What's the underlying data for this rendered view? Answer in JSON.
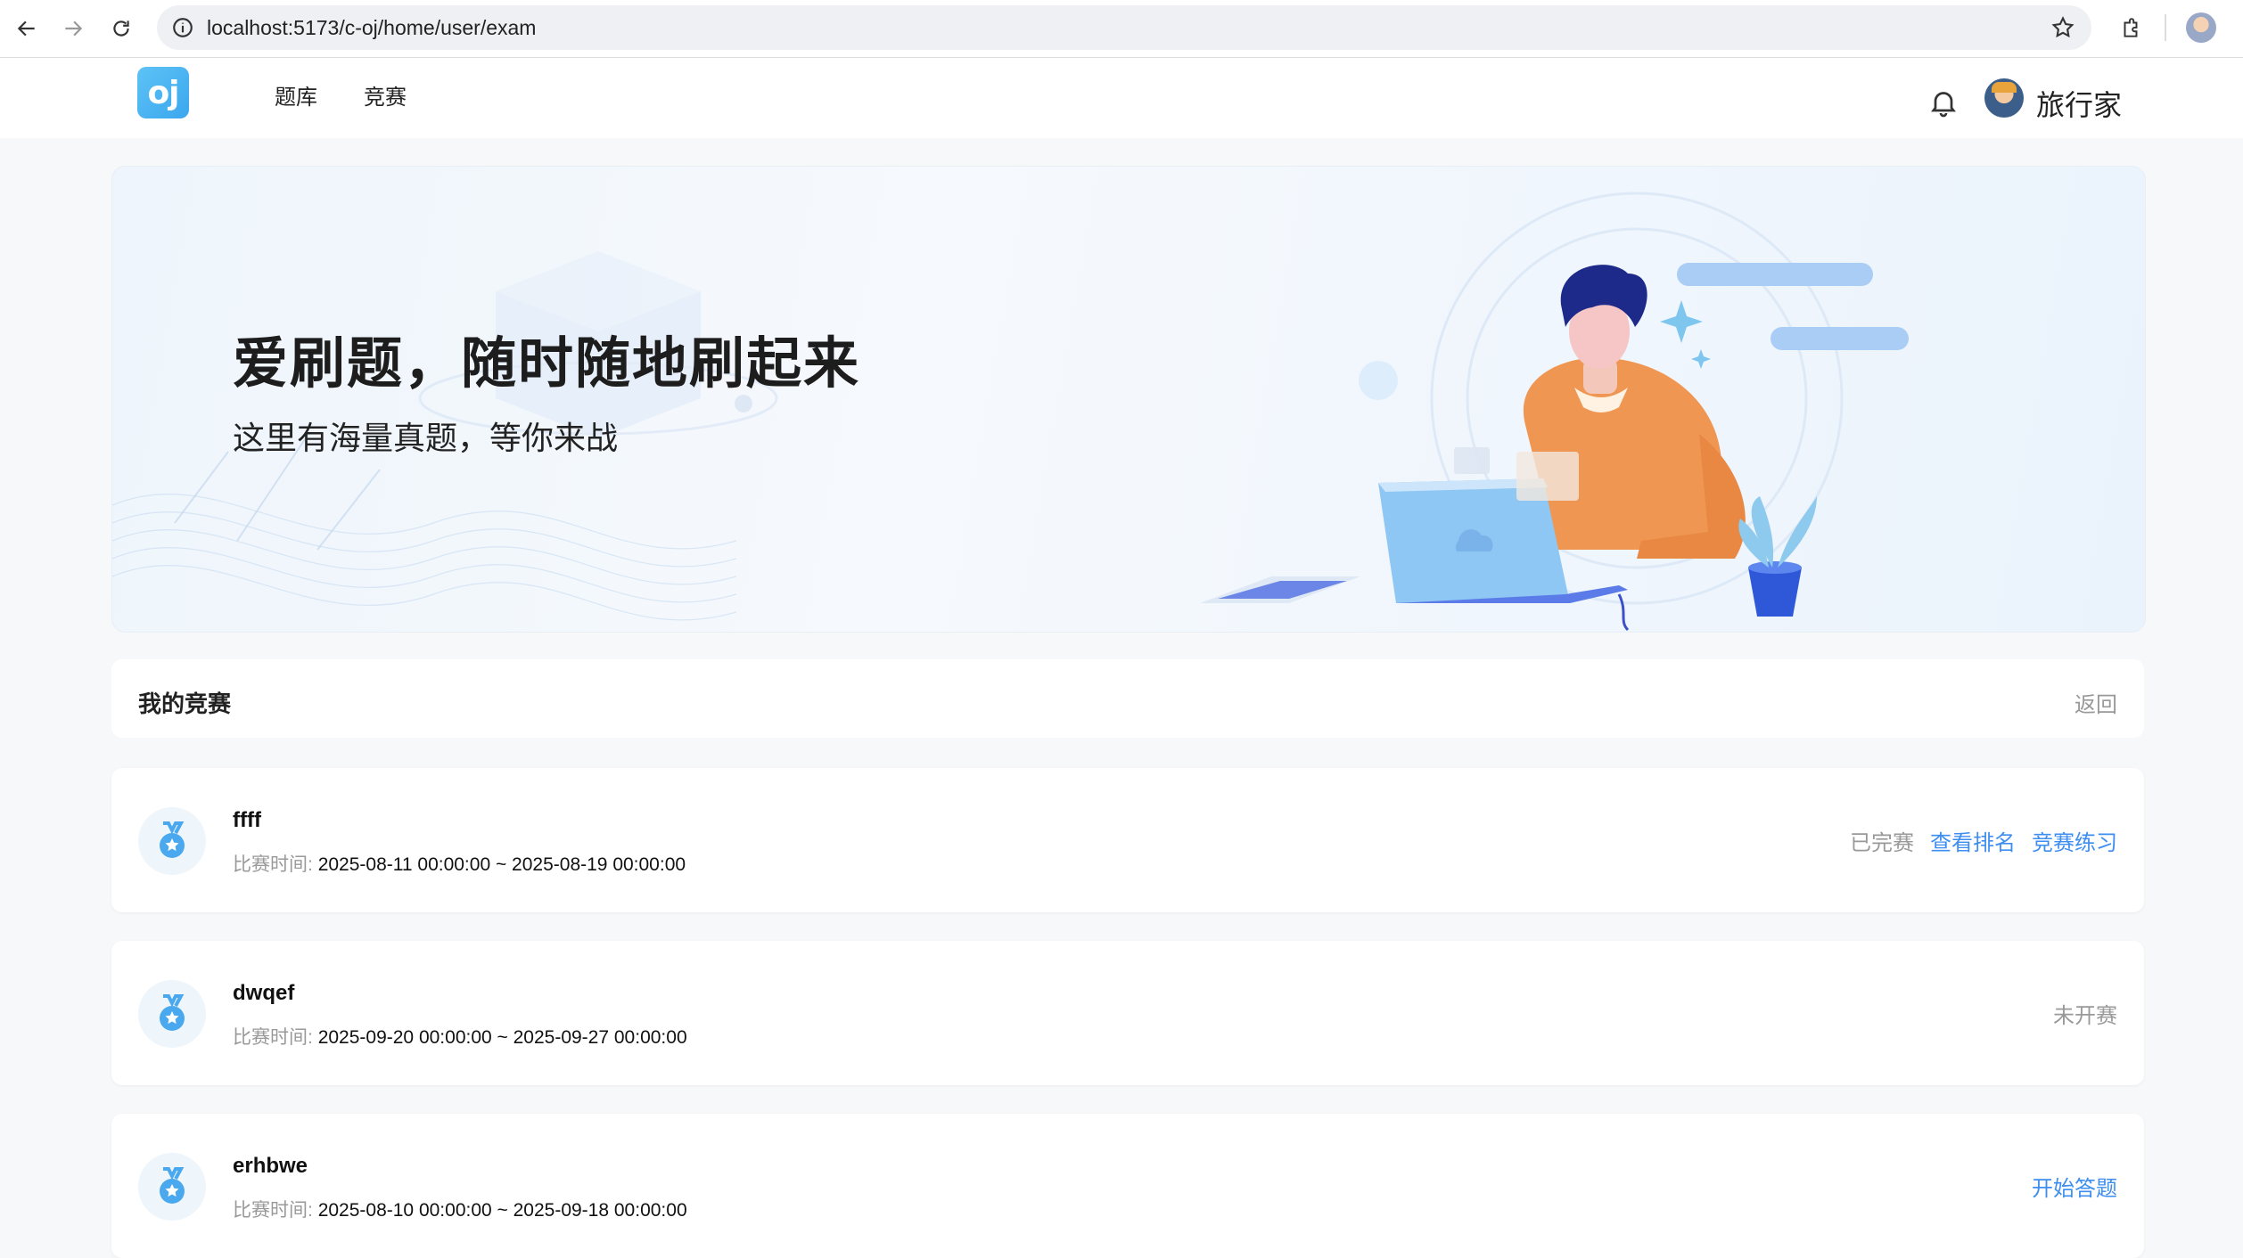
{
  "browser": {
    "url": "localhost:5173/c-oj/home/user/exam"
  },
  "header": {
    "logo_text": "oj",
    "nav": [
      {
        "label": "题库"
      },
      {
        "label": "竞赛"
      }
    ],
    "username": "旅行家"
  },
  "banner": {
    "title": "爱刷题，随时随地刷起来",
    "subtitle": "这里有海量真题，等你来战"
  },
  "section": {
    "title": "我的竞赛",
    "back_label": "返回"
  },
  "exams": [
    {
      "name": "ffff",
      "time_label": "比赛时间:",
      "time_value": "2025-08-11 00:00:00 ~ 2025-08-19 00:00:00",
      "status": "已完赛",
      "actions": [
        "查看排名",
        "竞赛练习"
      ]
    },
    {
      "name": "dwqef",
      "time_label": "比赛时间:",
      "time_value": "2025-09-20 00:00:00 ~ 2025-09-27 00:00:00",
      "status": "未开赛",
      "actions": []
    },
    {
      "name": "erhbwe",
      "time_label": "比赛时间:",
      "time_value": "2025-08-10 00:00:00 ~ 2025-09-18 00:00:00",
      "status": "",
      "actions": [
        "开始答题"
      ]
    }
  ],
  "colors": {
    "link": "#3e8ef0",
    "muted": "#999999",
    "logo": "#3aa7ee"
  }
}
